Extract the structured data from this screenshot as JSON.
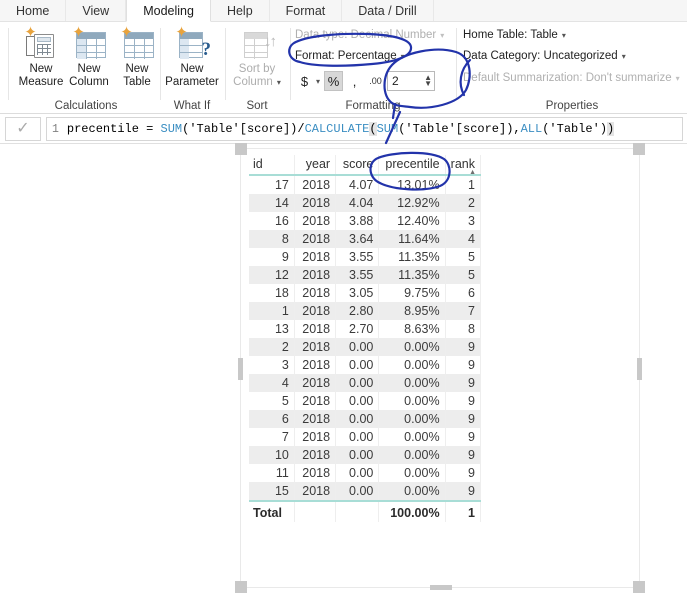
{
  "ribbon": {
    "tabs": [
      {
        "label": "Home",
        "active": false
      },
      {
        "label": "View",
        "active": false
      },
      {
        "label": "Modeling",
        "active": true
      },
      {
        "label": "Help",
        "active": false
      },
      {
        "label": "Format",
        "active": false
      },
      {
        "label": "Data / Drill",
        "active": false
      }
    ],
    "groups": {
      "calculations": {
        "label": "Calculations",
        "buttons": [
          {
            "name": "new-measure",
            "label": "New\nMeasure",
            "icon": "new-measure-icon",
            "disabled": false
          },
          {
            "name": "new-column",
            "label": "New\nColumn",
            "icon": "new-column-icon",
            "disabled": false
          },
          {
            "name": "new-table",
            "label": "New\nTable",
            "icon": "new-table-icon",
            "disabled": false
          }
        ]
      },
      "whatif": {
        "label": "What If",
        "buttons": [
          {
            "name": "new-parameter",
            "label": "New\nParameter",
            "icon": "new-parameter-icon",
            "disabled": false
          }
        ]
      },
      "sort": {
        "label": "Sort",
        "buttons": [
          {
            "name": "sort-by-column",
            "label": "Sort by\nColumn",
            "icon": "sort-by-column-icon",
            "disabled": true,
            "caret": "▾"
          }
        ]
      },
      "formatting": {
        "label": "Formatting",
        "data_type": "Data type: Decimal Number",
        "data_type_disabled": true,
        "format": "Format: Percentage",
        "currency_symbol": "$",
        "percent_symbol": "%",
        "comma_symbol": ",",
        "decimal_icon": ".00",
        "decimal_places": "2",
        "caret": "▾"
      },
      "properties": {
        "label": "Properties",
        "home_table": "Home Table: Table",
        "data_category": "Data Category: Uncategorized",
        "default_summarization": "Default Summarization: Don't summarize",
        "caret": "▾"
      }
    }
  },
  "formula_bar": {
    "commit_icon": "checkmark-icon",
    "line_number": "1",
    "measure_name": "precentile",
    "formula": "precentile = SUM('Table'[score])/CALCULATE(SUM('Table'[score]),ALL('Table'))",
    "parts": {
      "p1": "precentile = ",
      "fn_sum1": "SUM",
      "p2": "('Table'[score])/",
      "fn_calc": "CALCULATE",
      "p3": "(",
      "fn_sum2": "SUM",
      "p4": "('Table'[score]),",
      "fn_all": "ALL",
      "p5": "('Table')",
      "p6": ")"
    }
  },
  "visual": {
    "name": "table-visual",
    "columns": [
      "id",
      "year",
      "score",
      "precentile",
      "rank"
    ],
    "rows": [
      {
        "id": "17",
        "year": "2018",
        "score": "4.07",
        "precentile": "13.01%",
        "rank": "1"
      },
      {
        "id": "14",
        "year": "2018",
        "score": "4.04",
        "precentile": "12.92%",
        "rank": "2"
      },
      {
        "id": "16",
        "year": "2018",
        "score": "3.88",
        "precentile": "12.40%",
        "rank": "3"
      },
      {
        "id": "8",
        "year": "2018",
        "score": "3.64",
        "precentile": "11.64%",
        "rank": "4"
      },
      {
        "id": "9",
        "year": "2018",
        "score": "3.55",
        "precentile": "11.35%",
        "rank": "5"
      },
      {
        "id": "12",
        "year": "2018",
        "score": "3.55",
        "precentile": "11.35%",
        "rank": "5"
      },
      {
        "id": "18",
        "year": "2018",
        "score": "3.05",
        "precentile": "9.75%",
        "rank": "6"
      },
      {
        "id": "1",
        "year": "2018",
        "score": "2.80",
        "precentile": "8.95%",
        "rank": "7"
      },
      {
        "id": "13",
        "year": "2018",
        "score": "2.70",
        "precentile": "8.63%",
        "rank": "8"
      },
      {
        "id": "2",
        "year": "2018",
        "score": "0.00",
        "precentile": "0.00%",
        "rank": "9"
      },
      {
        "id": "3",
        "year": "2018",
        "score": "0.00",
        "precentile": "0.00%",
        "rank": "9"
      },
      {
        "id": "4",
        "year": "2018",
        "score": "0.00",
        "precentile": "0.00%",
        "rank": "9"
      },
      {
        "id": "5",
        "year": "2018",
        "score": "0.00",
        "precentile": "0.00%",
        "rank": "9"
      },
      {
        "id": "6",
        "year": "2018",
        "score": "0.00",
        "precentile": "0.00%",
        "rank": "9"
      },
      {
        "id": "7",
        "year": "2018",
        "score": "0.00",
        "precentile": "0.00%",
        "rank": "9"
      },
      {
        "id": "10",
        "year": "2018",
        "score": "0.00",
        "precentile": "0.00%",
        "rank": "9"
      },
      {
        "id": "11",
        "year": "2018",
        "score": "0.00",
        "precentile": "0.00%",
        "rank": "9"
      },
      {
        "id": "15",
        "year": "2018",
        "score": "0.00",
        "precentile": "0.00%",
        "rank": "9"
      }
    ],
    "total": {
      "label": "Total",
      "year": "",
      "score": "",
      "precentile": "100.00%",
      "rank": "1"
    }
  },
  "annotations": {
    "color": "#2233aa",
    "marks": [
      {
        "name": "circle-format-percentage",
        "target": "Format: Percentage"
      },
      {
        "name": "circle-decimal-places",
        "target": "2"
      },
      {
        "name": "circle-precentile-header",
        "target": "precentile"
      },
      {
        "name": "arc-properties",
        "target": "Default Summarization"
      }
    ]
  }
}
